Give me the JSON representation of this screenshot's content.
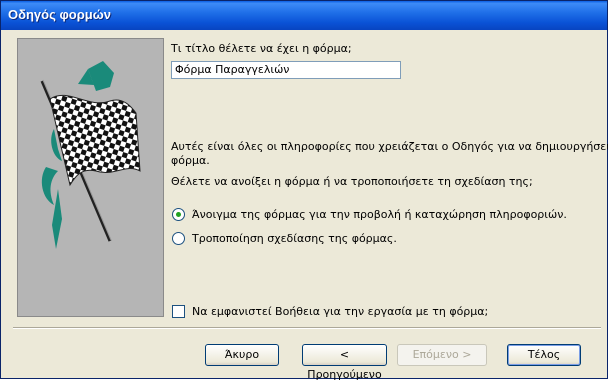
{
  "window": {
    "title": "Οδηγός φορμών"
  },
  "form_title": {
    "question": "Τι τίτλο θέλετε να έχει η φόρμα;",
    "value": "Φόρμα Παραγγελιών"
  },
  "info": {
    "line1": "Αυτές είναι όλες οι πληροφορίες που χρειάζεται ο Οδηγός για να δημιουργήσει τη",
    "line2": "φόρμα.",
    "open_question": "Θέλετε να ανοίξει η φόρμα ή να τροποποιήσετε τη σχεδίαση της;"
  },
  "options": {
    "open_form": "Άνοιγμα της φόρμας για την προβολή ή καταχώρηση πληροφοριών.",
    "modify_design": "Τροποποίηση σχεδίασης της φόρμας.",
    "selected": "open_form"
  },
  "help_checkbox": {
    "label": "Να εμφανιστεί Βοήθεια για την εργασία με τη φόρμα;",
    "checked": false
  },
  "buttons": {
    "cancel": "Άκυρο",
    "back": "< Προηγούμενο",
    "next": "Επόμενο >",
    "finish": "Τέλος"
  },
  "colors": {
    "title_bar": "#0a52d6",
    "flag_accent": "#1a8a7a",
    "panel": "#b5b5b5"
  },
  "icons": {
    "illustration": "checkered-flag"
  }
}
